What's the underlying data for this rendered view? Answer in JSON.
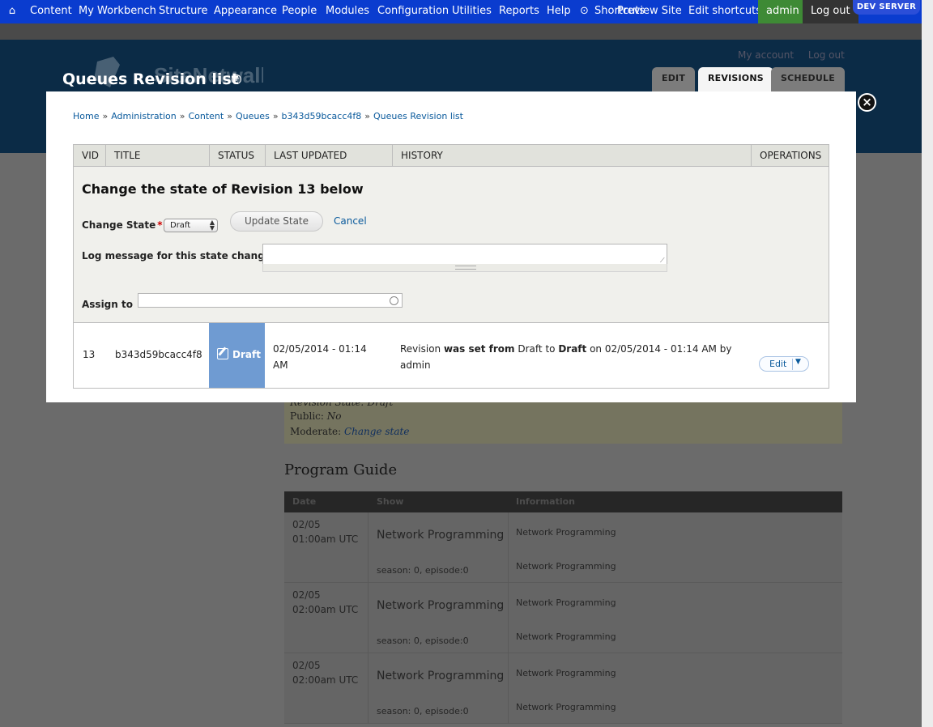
{
  "toolbar": {
    "items": [
      "Content",
      "My Workbench",
      "Structure",
      "Appearance",
      "People",
      "Modules",
      "Configuration",
      "Utilities",
      "Reports",
      "Help"
    ],
    "shortcuts": "Shortcuts",
    "preview_site": "Preview Site",
    "edit_shortcuts": "Edit shortcuts",
    "admin": "admin",
    "logout": "Log out",
    "dev_server": "DEV SERVER"
  },
  "header": {
    "title": "Queues Revision list",
    "site_name": "SiteNetwall",
    "my_account": "My account",
    "log_out": "Log out",
    "tabs": [
      "EDIT",
      "REVISIONS",
      "SCHEDULE"
    ],
    "active_tab": "REVISIONS"
  },
  "background": {
    "revision_state": "Revision State: Draft",
    "public_label": "Public:",
    "public_value": "No",
    "moderate_label": "Moderate:",
    "moderate_link": "Change state",
    "program_guide_title": "Program Guide",
    "pg_columns": [
      "Date",
      "Show",
      "Information"
    ],
    "pg_rows": [
      {
        "date": "02/05 01:00am UTC",
        "show": "Network Programming",
        "episode": "season: 0, episode:0",
        "info1": "Network Programming",
        "info2": "Network Programming"
      },
      {
        "date": "02/05 02:00am UTC",
        "show": "Network Programming",
        "episode": "season: 0, episode:0",
        "info1": "Network Programming",
        "info2": "Network Programming"
      },
      {
        "date": "02/05 02:00am UTC",
        "show": "Network Programming",
        "episode": "season: 0, episode:0",
        "info1": "Network Programming",
        "info2": "Network Programming"
      }
    ]
  },
  "modal": {
    "breadcrumb": [
      "Home",
      "Administration",
      "Content",
      "Queues",
      "b343d59bcacc4f8",
      "Queues Revision list"
    ],
    "columns": [
      "VID",
      "TITLE",
      "STATUS",
      "LAST UPDATED",
      "HISTORY",
      "OPERATIONS"
    ],
    "form": {
      "title": "Change the state of Revision 13 below",
      "change_state_label": "Change State",
      "required_mark": "*",
      "state_value": "Draft",
      "update_button": "Update State",
      "cancel": "Cancel",
      "log_label": "Log message for this state change",
      "log_value": "",
      "assign_label": "Assign to",
      "assign_value": ""
    },
    "row": {
      "vid": "13",
      "title": "b343d59bcacc4f8",
      "status": "Draft",
      "last_updated": "02/05/2014 - 01:14 AM",
      "history_pre": "Revision ",
      "history_b1": "was set from",
      "history_mid": " Draft to ",
      "history_b2": "Draft",
      "history_post": " on 02/05/2014 - 01:14 AM by admin",
      "operation": "Edit"
    }
  },
  "colors": {
    "toolbar": "#0a3ccf",
    "header": "#0b2b46",
    "status_draft": "#6f9bd2",
    "link": "#0a5a9c"
  }
}
